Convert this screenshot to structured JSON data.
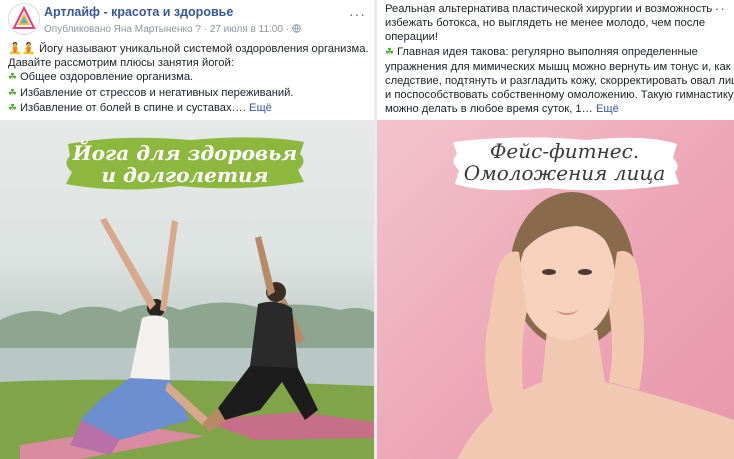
{
  "left_post": {
    "page_name": "Артлайф - красота и здоровье",
    "published_by": "Опубликовано Яна Мартыненко",
    "help_marker": "?",
    "date": "27 июля в 11:00",
    "globe_icon": "globe-icon",
    "more_icon": "···",
    "lines": [
      "🧘🧘 Йогу называют уникальной системой оздоровления организма.",
      "Давайте рассмотрим плюсы занятия йогой:"
    ],
    "bullets": [
      "Общее оздоровление организма.",
      "Избавление от стрессов и негативных переживаний.",
      "Избавление от болей в спине и суставах…."
    ],
    "see_more": "Ещё",
    "image_title_line1": "Йога для здоровья",
    "image_title_line2": "и долголетия"
  },
  "right_post": {
    "more_icon": "···",
    "lines": [
      "Реальная альтернатива пластической хирургии и возможность",
      "избежать ботокса, но выглядеть не менее молодо, чем после",
      "операции!"
    ],
    "main_idea_lines": [
      "Главная идея такова: регулярно выполняя определенные",
      "упражнения для мимических мышц можно вернуть им тонус и, как",
      "следствие, подтянуть и разгладить кожу, скорректировать овал лица",
      "и поспособствовать собственному омоложению. Такую гимнастику",
      "можно делать в любое время суток, 1…"
    ],
    "see_more": "Ещё",
    "image_title_line1": "Фейс-фитнес.",
    "image_title_line2": "Омоложения лица"
  },
  "colors": {
    "link": "#385898",
    "meta": "#90949c",
    "leaf": "#5aa53a",
    "brush_green": "#8db83e",
    "pink_bg": "#eda6b6"
  }
}
